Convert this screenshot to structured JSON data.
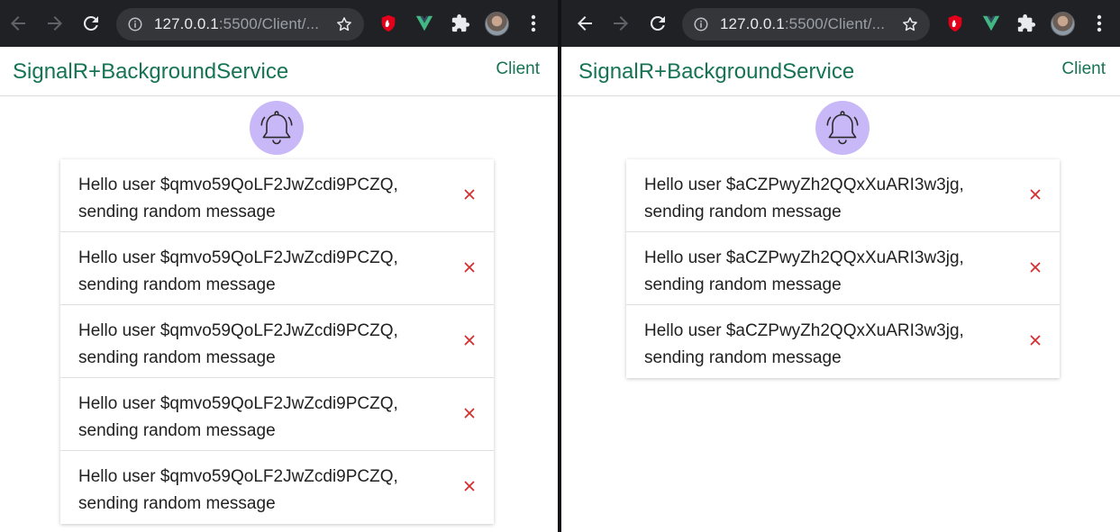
{
  "browser": {
    "url_host": "127.0.0.1",
    "url_rest": ":5500/Client/..."
  },
  "app": {
    "brand": "SignalR+BackgroundService",
    "nav_link": "Client"
  },
  "left_window": {
    "messages": [
      {
        "line1": "Hello user $qmvo59QoLF2JwZcdi9PCZQ,",
        "line2": "sending random message"
      },
      {
        "line1": "Hello user $qmvo59QoLF2JwZcdi9PCZQ,",
        "line2": "sending random message"
      },
      {
        "line1": "Hello user $qmvo59QoLF2JwZcdi9PCZQ,",
        "line2": "sending random message"
      },
      {
        "line1": "Hello user $qmvo59QoLF2JwZcdi9PCZQ,",
        "line2": "sending random message"
      },
      {
        "line1": "Hello user $qmvo59QoLF2JwZcdi9PCZQ,",
        "line2": "sending random message"
      }
    ]
  },
  "right_window": {
    "messages": [
      {
        "line1": "Hello user $aCZPwyZh2QQxXuARI3w3jg,",
        "line2": "sending random message"
      },
      {
        "line1": "Hello user $aCZPwyZh2QQxXuARI3w3jg,",
        "line2": "sending random message"
      },
      {
        "line1": "Hello user $aCZPwyZh2QQxXuARI3w3jg,",
        "line2": "sending random message"
      }
    ]
  },
  "icons": {
    "back": "back-arrow-icon",
    "forward": "forward-arrow-icon",
    "reload": "reload-icon",
    "site_info": "info-icon",
    "bookmark": "star-icon",
    "ext_1": "ublock-icon",
    "ext_2": "vue-devtools-icon",
    "ext_3": "puzzle-icon",
    "profile": "avatar",
    "menu": "kebab-menu-icon",
    "notification": "bell-icon",
    "dismiss": "close-icon"
  },
  "colors": {
    "brand_green": "#167354",
    "bell_circle": "#c9b8f7",
    "close_red": "#d32f2f",
    "chrome_dark": "#202124",
    "ublock_red": "#e3001b",
    "vue_green": "#41b883"
  }
}
